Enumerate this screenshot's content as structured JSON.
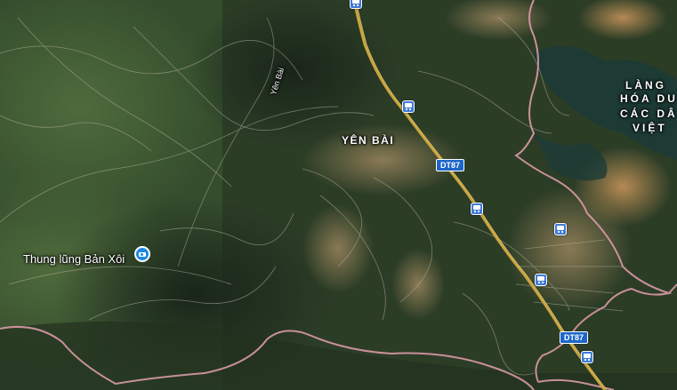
{
  "map": {
    "view": "satellite",
    "places": {
      "yen_bai": "YÊN BÀI",
      "thung_lung": "Thung lũng Bản Xôi",
      "lang_line1": "LÀNG",
      "lang_line2": "HÓA DU",
      "lang_line3": "CÁC DÂ",
      "lang_line4": "VIỆT"
    },
    "road_names": {
      "yen_bai_road": "Yên Bài"
    },
    "route_shields": {
      "dt87_upper": "DT87",
      "dt87_lower": "DT87"
    },
    "icons": {
      "poi": "camera-icon",
      "transit": "bus-stop-icon"
    },
    "colors": {
      "boundary": "#d99aa6",
      "highway": "#c9a43c",
      "shield": "#1d66c9",
      "transit": "#3e7bd8",
      "poi": "#1e88e5"
    }
  }
}
